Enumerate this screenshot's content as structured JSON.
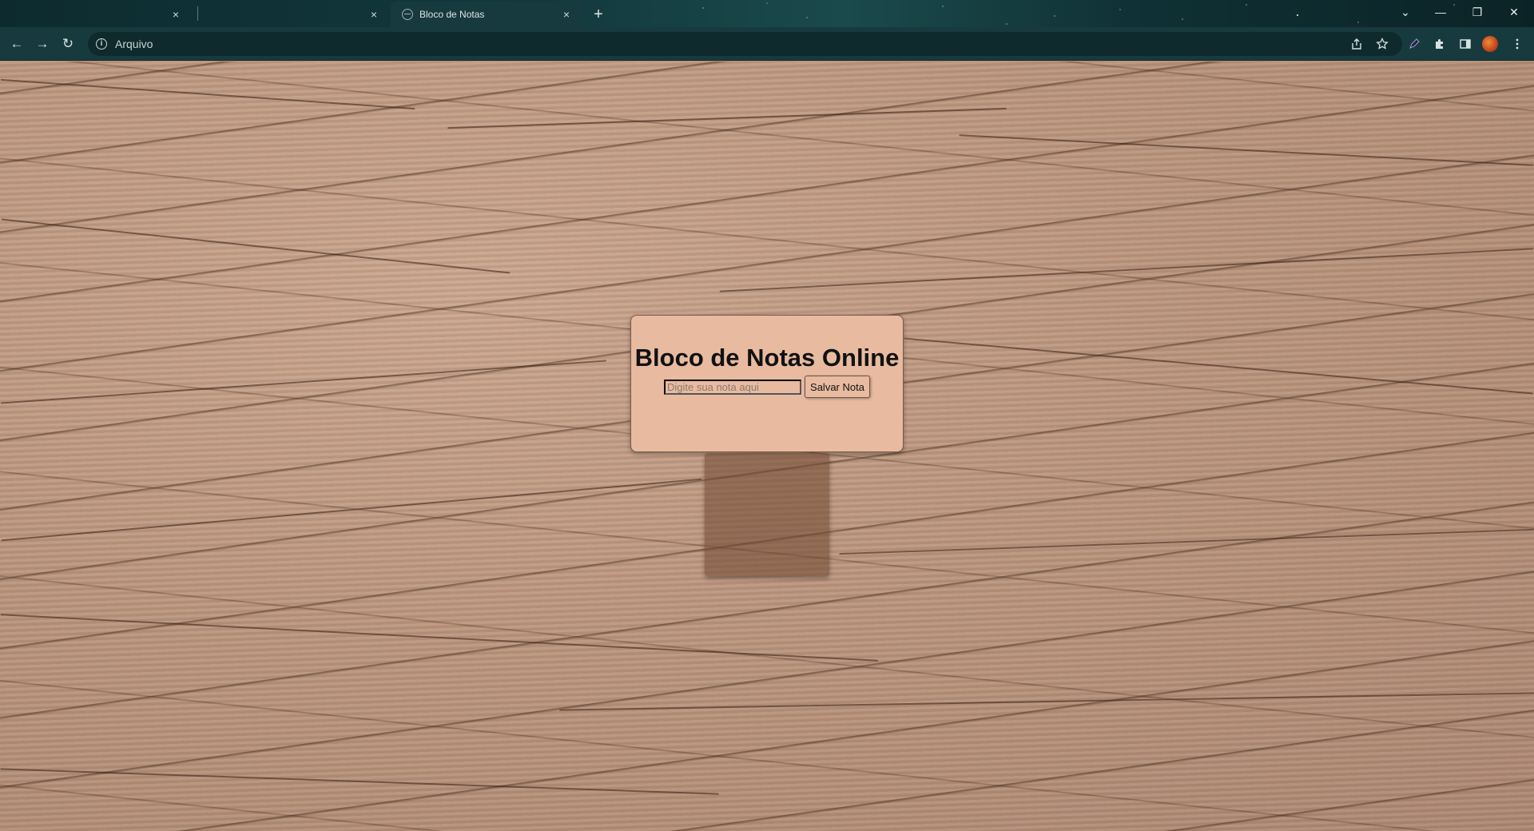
{
  "browser": {
    "tabs": [
      {
        "title": "",
        "close": "×"
      },
      {
        "title": "",
        "close": "×"
      },
      {
        "title": "Bloco de Notas",
        "close": "×",
        "active": true
      }
    ],
    "new_tab": "+",
    "window_controls": {
      "tab_search": "⌄",
      "minimize": "—",
      "restore": "❐",
      "close": "✕"
    },
    "nav": {
      "back": "←",
      "forward": "→",
      "reload": "↻"
    },
    "address": {
      "security_label": "Arquivo",
      "url": ""
    },
    "toolbar_icons": [
      "share-icon",
      "star-icon",
      "pen-icon",
      "extensions-icon",
      "side-panel-icon",
      "avatar",
      "kebab-menu-icon"
    ]
  },
  "page": {
    "title": "Bloco de Notas Online",
    "input_placeholder": "Digite sua nota aqui",
    "input_value": "",
    "save_label": "Salvar Nota",
    "notes": []
  },
  "colors": {
    "card_bg": "#e8bba0",
    "tab_bg": "#173a3e",
    "frame": "#0d2b2f"
  }
}
